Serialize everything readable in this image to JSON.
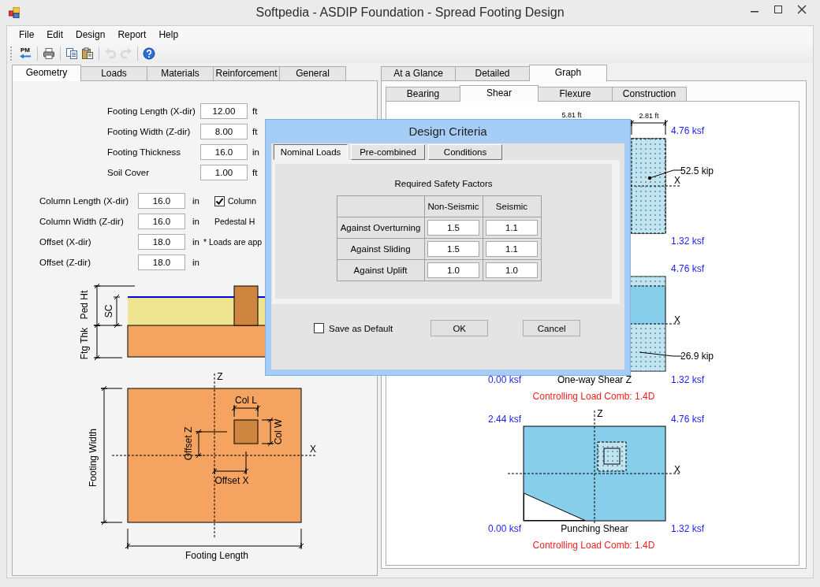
{
  "window": {
    "title": "Softpedia - ASDIP Foundation - Spread Footing Design"
  },
  "menu": [
    "File",
    "Edit",
    "Design",
    "Report",
    "Help"
  ],
  "toolbar": [
    {
      "kind": "pm",
      "text": "PM",
      "disabled": false
    },
    {
      "kind": "print",
      "disabled": false
    },
    {
      "kind": "copy",
      "disabled": false
    },
    {
      "kind": "paste",
      "disabled": false
    },
    {
      "kind": "undo",
      "disabled": true
    },
    {
      "kind": "redo",
      "disabled": true
    },
    {
      "kind": "help",
      "disabled": false
    }
  ],
  "input_tabs": [
    {
      "label": "Geometry",
      "selected": true
    },
    {
      "label": "Loads",
      "selected": false
    },
    {
      "label": "Materials",
      "selected": false
    },
    {
      "label": "Reinforcement",
      "selected": false
    },
    {
      "label": "General",
      "selected": false
    }
  ],
  "footing_fields": [
    {
      "label": "Footing Length (X-dir)",
      "value": "12.00",
      "unit": "ft"
    },
    {
      "label": "Footing Width (Z-dir)",
      "value": "8.00",
      "unit": "ft"
    },
    {
      "label": "Footing Thickness",
      "value": "16.0",
      "unit": "in"
    },
    {
      "label": "Soil Cover",
      "value": "1.00",
      "unit": "ft"
    }
  ],
  "column_fields": [
    {
      "label": "Column Length (X-dir)",
      "value": "16.0",
      "unit": "in"
    },
    {
      "label": "Column Width (Z-dir)",
      "value": "16.0",
      "unit": "in"
    },
    {
      "label": "Offset (X-dir)",
      "value": "18.0",
      "unit": "in"
    },
    {
      "label": "Offset (Z-dir)",
      "value": "18.0",
      "unit": "in"
    }
  ],
  "column_option": {
    "label": "Column",
    "checked": true
  },
  "pedestal_label": "Pedestal H",
  "loads_note": "* Loads are app",
  "elevation": {
    "ped_ht": "Ped Ht",
    "sc": "SC",
    "ftg_thk": "Ftg Thk"
  },
  "plan": {
    "z_axis": "Z",
    "x_axis": "X",
    "col_l": "Col L",
    "col_w": "Col W",
    "offset_z": "Offset Z",
    "offset_x": "Offset X",
    "footing_width": "Footing Width",
    "footing_length": "Footing Length"
  },
  "result_tabs": [
    {
      "label": "At a Glance",
      "selected": false
    },
    {
      "label": "Detailed",
      "selected": false
    },
    {
      "label": "Graph",
      "selected": true
    }
  ],
  "graph_tabs": [
    {
      "label": "Bearing",
      "selected": false
    },
    {
      "label": "Shear",
      "selected": true
    },
    {
      "label": "Flexure",
      "selected": false
    },
    {
      "label": "Construction",
      "selected": false
    }
  ],
  "shear": {
    "one_way_x": {
      "dim_left": "5.81 ft",
      "dim_right": "2.81 ft",
      "top_right": "4.76 ksf",
      "force": "52.5 kip",
      "axis": "X",
      "bottom_right": "1.32 ksf"
    },
    "one_way_z": {
      "top_right": "4.76 ksf",
      "axis": "X",
      "force": "26.9 kip",
      "bottom_left": "0.00 ksf",
      "title": "One-way Shear Z",
      "bottom_right": "1.32 ksf",
      "combo": "Controlling Load Comb: 1.4D"
    },
    "punching": {
      "top_left": "2.44 ksf",
      "top_right": "4.76 ksf",
      "axis_z": "Z",
      "axis_x": "X",
      "bottom_left": "0.00 ksf",
      "title": "Punching Shear",
      "bottom_right": "1.32 ksf",
      "combo": "Controlling Load Comb: 1.4D"
    }
  },
  "dialog": {
    "title": "Design Criteria",
    "tabs": [
      {
        "label": "Nominal Loads",
        "selected": true
      },
      {
        "label": "Pre-combined",
        "selected": false
      },
      {
        "label": "Conditions",
        "selected": false
      }
    ],
    "heading": "Required Safety Factors",
    "columns": [
      "Non-Seismic",
      "Seismic"
    ],
    "rows": [
      {
        "label": "Against Overturning",
        "values": [
          "1.5",
          "1.1"
        ]
      },
      {
        "label": "Against Sliding",
        "values": [
          "1.5",
          "1.1"
        ]
      },
      {
        "label": "Against Uplift",
        "values": [
          "1.0",
          "1.0"
        ]
      }
    ],
    "save_default": {
      "label": "Save as Default",
      "checked": false
    },
    "buttons": [
      "OK",
      "Cancel"
    ]
  }
}
